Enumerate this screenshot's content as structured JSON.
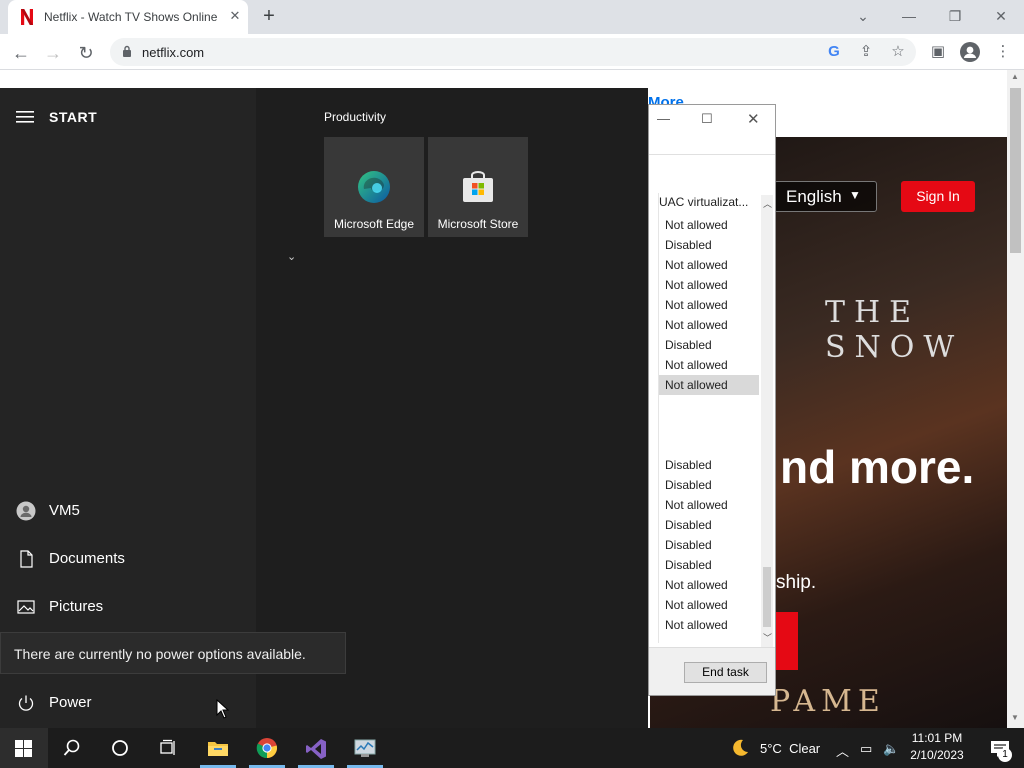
{
  "browser": {
    "tab_title": "Netflix - Watch TV Shows Online",
    "url": "netflix.com",
    "colors": {
      "netflix_red": "#e50914",
      "tabstrip": "#dee1e6"
    }
  },
  "netflix": {
    "more_link": "More",
    "language": "English",
    "sign_in": "Sign In",
    "snow_text": "THE SNOW",
    "headline_fragment": "nd more.",
    "sub_fragment": "ship.",
    "pame_text": "PAME"
  },
  "task_manager": {
    "column_header": "UAC virtualizat...",
    "rows": [
      "Not allowed",
      "Disabled",
      "Not allowed",
      "Not allowed",
      "Not allowed",
      "Not allowed",
      "Disabled",
      "Not allowed",
      "Not allowed",
      "",
      "",
      "",
      "Disabled",
      "Disabled",
      "Not allowed",
      "Disabled",
      "Disabled",
      "Disabled",
      "Not allowed",
      "Not allowed",
      "Not allowed"
    ],
    "selected_index": 8,
    "end_task": "End task"
  },
  "start_menu": {
    "header": "START",
    "user": "VM5",
    "documents": "Documents",
    "pictures": "Pictures",
    "power": "Power",
    "power_tooltip": "There are currently no power options available.",
    "group_label": "Productivity",
    "tiles": [
      {
        "label": "Microsoft Edge",
        "icon": "edge-icon"
      },
      {
        "label": "Microsoft Store",
        "icon": "store-icon"
      }
    ]
  },
  "taskbar": {
    "weather_temp": "5°C",
    "weather_desc": "Clear",
    "time": "11:01 PM",
    "date": "2/10/2023",
    "notification_count": "1"
  }
}
